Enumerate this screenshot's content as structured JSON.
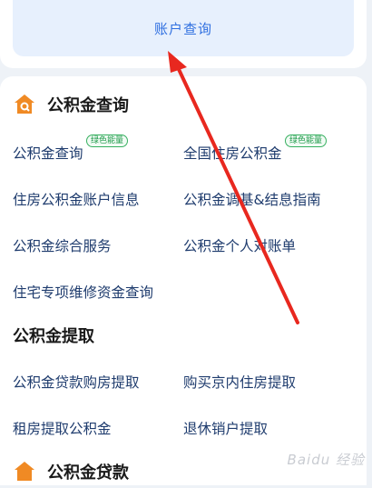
{
  "top": {
    "account_query_label": "账户查询"
  },
  "sections": {
    "provident_query": {
      "title": "公积金查询",
      "links": {
        "query": "公积金查询",
        "national": "全国住房公积金",
        "account_info": "住房公积金账户信息",
        "deposit_guide": "公积金调基&结息指南",
        "comprehensive": "公积金综合服务",
        "statement": "公积金个人对账单",
        "maintenance": "住宅专项维修资金查询"
      },
      "badges": {
        "query": "绿色能量",
        "national": "绿色能量"
      }
    },
    "withdraw": {
      "title": "公积金提取",
      "links": {
        "loan_purchase": "公积金贷款购房提取",
        "buy_in_beijing": "购买京内住房提取",
        "rent": "租房提取公积金",
        "retire": "退休销户提取"
      }
    },
    "loan": {
      "title": "公积金贷款"
    }
  },
  "watermark": "Baidu 经验",
  "colors": {
    "accent": "#2f6fe0",
    "badge": "#1e9a4a",
    "arrow": "#e8281f",
    "icon": "#f08a24"
  }
}
